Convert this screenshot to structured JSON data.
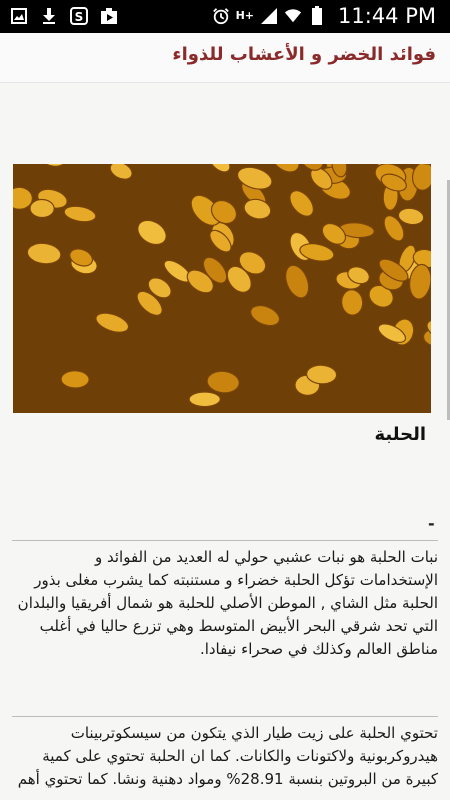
{
  "status_bar": {
    "time": "11:44 PM",
    "network": "H+",
    "left_icons": [
      "gallery-icon",
      "download-icon",
      "shazam-icon",
      "media-icon"
    ],
    "right_icons": [
      "alarm-icon",
      "signal-icon",
      "wifi-icon",
      "battery-icon"
    ]
  },
  "header": {
    "title": "فوائد الخضر و الأعشاب للذواء"
  },
  "article": {
    "herb_name": "الحلبة",
    "separator": "-",
    "paragraph1": [
      "نبات الحلبة هو نبات عشبي حولي له العديد من الفوائد و",
      "الإستخدامات تؤكل الحلبة خضراء و مستنبته كما يشرب مغلى بذور",
      "الحلبة مثل الشاي , الموطن الأصلي للحلبة هو شمال أفريقيا والبلدان",
      "التي تحد شرقي البحر الأبيض المتوسط وهي تزرع حاليا في أغلب",
      "مناطق العالم وكذلك في صحراء نيفادا."
    ],
    "paragraph2": [
      "تحتوي الحلبة على زيت طيار الذي يتكون من سيسكوتربينات",
      "هيدروكربونية ولاكتونات والكانات. كما ان الحلبة تحتوي على كمية",
      "كبيرة من البروتين بنسبة 28.91% ومواد دهنية ونشا. كما تحتوي أهم"
    ]
  },
  "colors": {
    "title": "#8b2a2a",
    "status_bar": "#000000",
    "background": "#f6f6f4"
  }
}
